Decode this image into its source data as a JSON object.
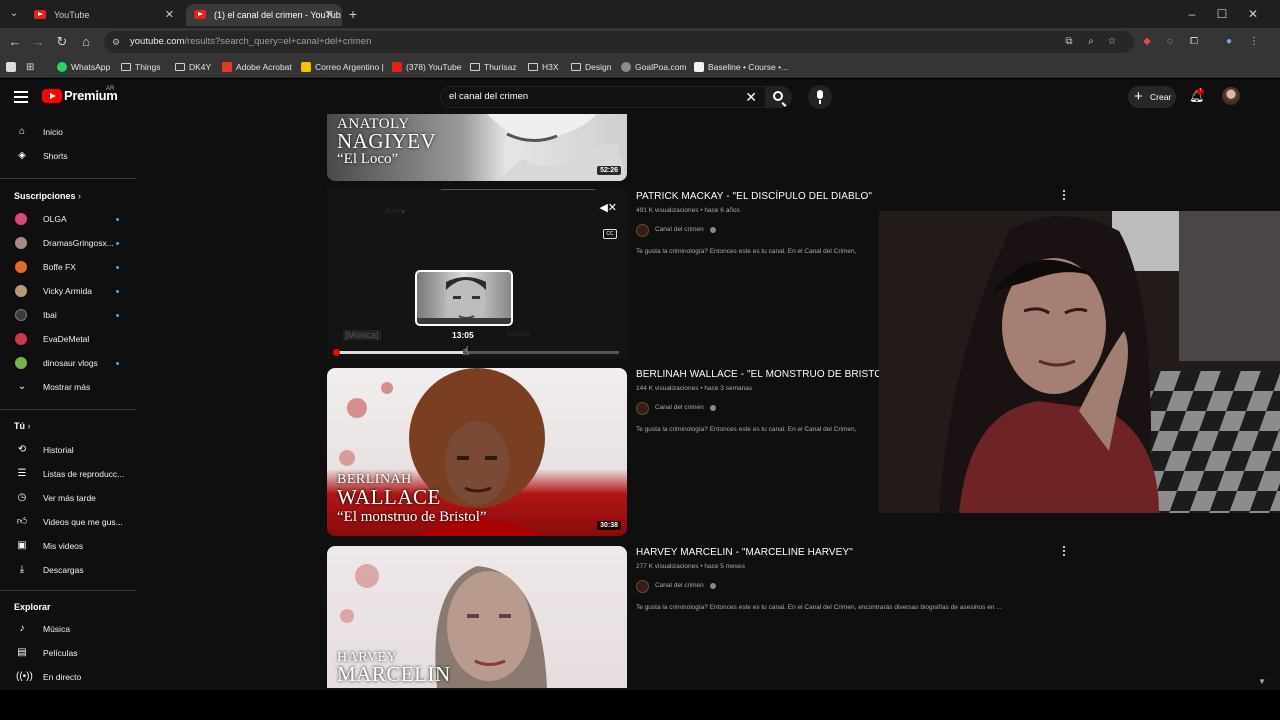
{
  "browser": {
    "tabs": [
      {
        "label": "YouTube"
      },
      {
        "label": "(1) el canal del crimen - YouTub"
      }
    ],
    "url": {
      "host": "youtube.com",
      "path": "/results?search_query=el+canal+del+crimen"
    },
    "bookmarks": [
      {
        "label": "WhatsApp"
      },
      {
        "label": "Things"
      },
      {
        "label": "DK4Y"
      },
      {
        "label": "Adobe Acrobat"
      },
      {
        "label": "Correo Argentino |"
      },
      {
        "label": "(378) YouTube"
      },
      {
        "label": "Thurisaz"
      },
      {
        "label": "H3X"
      },
      {
        "label": "Design"
      },
      {
        "label": "GoalPoa.com"
      },
      {
        "label": "Baseline • Course •..."
      }
    ]
  },
  "header": {
    "logo": "Premium",
    "region": "AR",
    "search_query": "el canal del crimen",
    "create_label": "Crear",
    "notif_badge": "!"
  },
  "sidebar": {
    "main": [
      {
        "label": "Inicio",
        "icon": "home-icon"
      },
      {
        "label": "Shorts",
        "icon": "shorts-icon"
      }
    ],
    "subs_title": "Suscripciones",
    "subs": [
      {
        "label": "OLGA",
        "color": "#d9467a"
      },
      {
        "label": "DramasGringosx...",
        "color": "#a88"
      },
      {
        "label": "Boffe FX",
        "color": "#e26b2a"
      },
      {
        "label": "Vicky Armida",
        "color": "#b89a78"
      },
      {
        "label": "Ibai",
        "color": "#3c3c3c"
      },
      {
        "label": "EvaDeMetal",
        "color": "#c83a4a"
      },
      {
        "label": "dinosaur vlogs",
        "color": "#7ab04a"
      }
    ],
    "show_more": "Mostrar más",
    "you_title": "Tú",
    "you": [
      {
        "label": "Historial"
      },
      {
        "label": "Listas de reproducc..."
      },
      {
        "label": "Ver más tarde"
      },
      {
        "label": "Videos que me gus..."
      },
      {
        "label": "Mis videos"
      },
      {
        "label": "Descargas"
      }
    ],
    "explore_title": "Explorar",
    "explore": [
      {
        "label": "Música"
      },
      {
        "label": "Películas"
      },
      {
        "label": "En directo"
      }
    ]
  },
  "videos": [
    {
      "overlay_line1": "ANATOLY",
      "overlay_line2": "NAGIYEV",
      "overlay_line3": "“El Loco”",
      "duration": "52:26"
    },
    {
      "title": "PATRICK MACKAY - \"EL DISCÍPULO DEL DIABLO\"",
      "meta": "491 K visualizaciones • hace 6 años",
      "channel": "Canal del crimen",
      "desc": "Te gusta la criminología? Entonces este es tu canal. En el Canal del Crimen,",
      "hover_time": "13:05",
      "play_hint": "PLAY ▶",
      "music_caption": "[Música]",
      "elapsed": "00:00:07",
      "progress": 0.45
    },
    {
      "title": "BERLINAH WALLACE - \"EL MONSTRUO DE BRISTO",
      "meta": "144 K visualizaciones • hace 3 semanas",
      "channel": "Canal del crimen",
      "desc": "Te gusta la criminología? Entonces este es tu canal. En el Canal del Crimen,",
      "overlay_line1": "BERLINAH",
      "overlay_line2": "WALLACE",
      "overlay_line3": "“El monstruo de Bristol”",
      "duration": "30:38"
    },
    {
      "title": "HARVEY MARCELIN - \"MARCELINE HARVEY\"",
      "meta": "277 K visualizaciones • hace 5 meses",
      "channel": "Canal del crimen",
      "desc": "Te gusta la criminología? Entonces este es tu canal. En el Canal del Crimen, encontrarás diversas biografías de asesinos en ...",
      "overlay_line1": "HARVEY",
      "overlay_line2": "MARCELIN"
    }
  ]
}
